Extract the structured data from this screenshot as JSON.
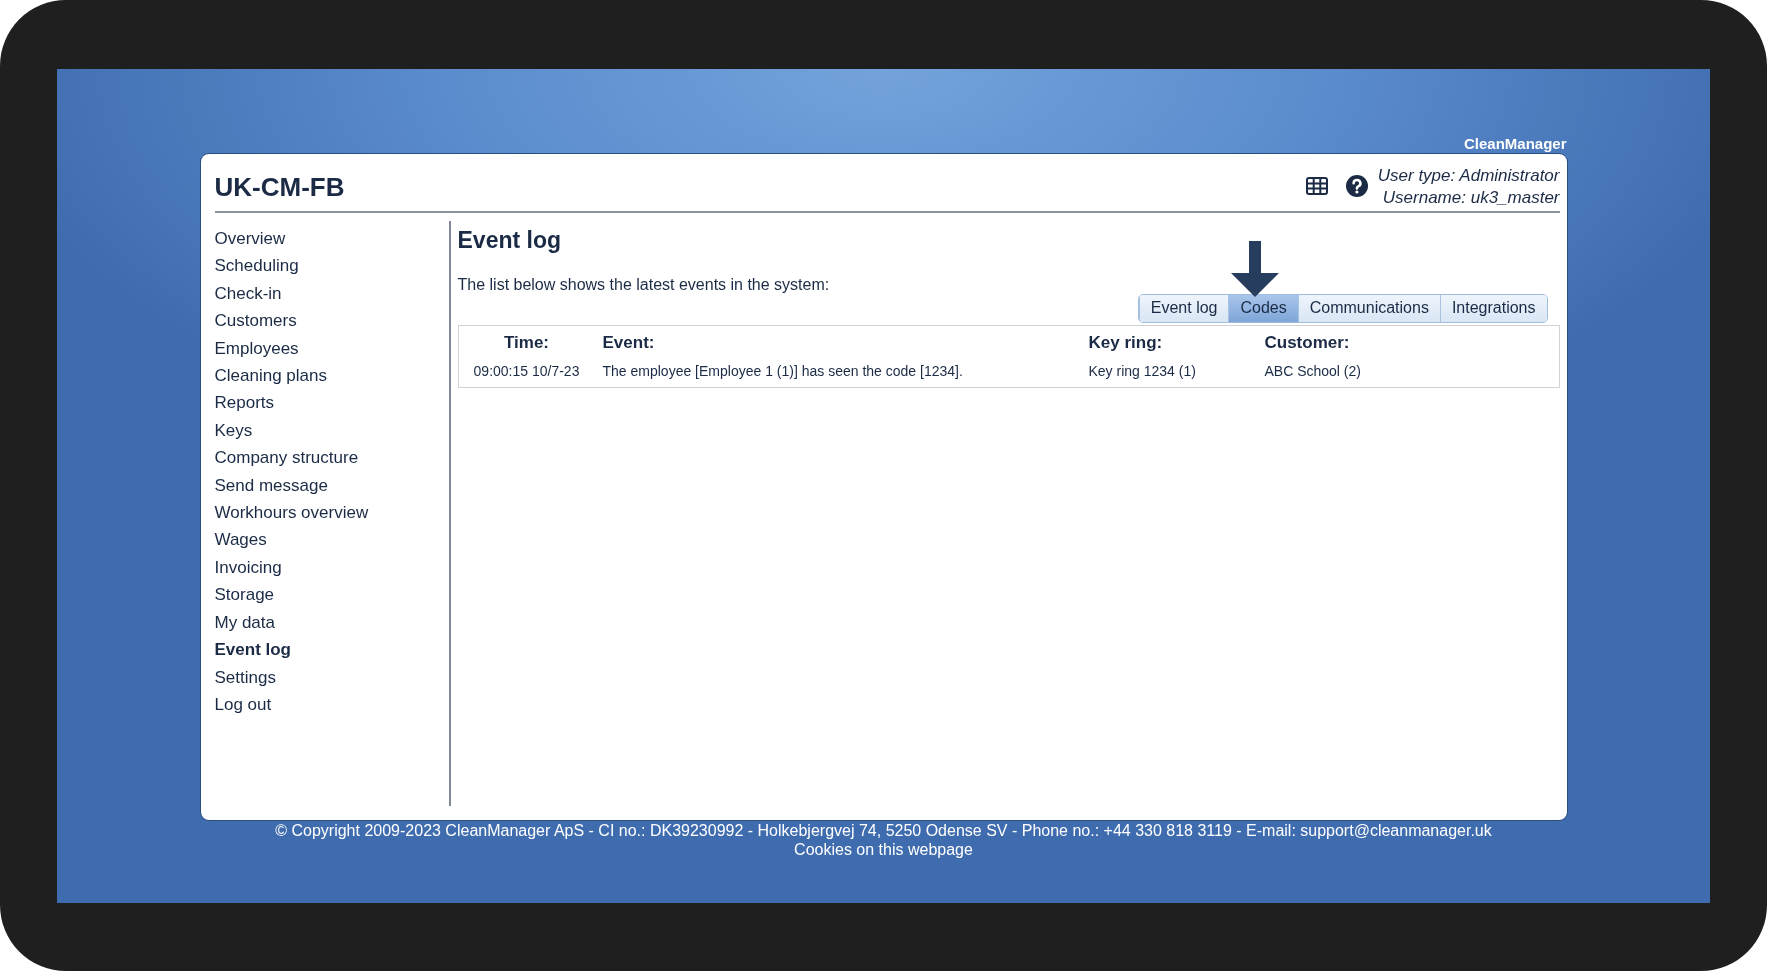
{
  "brand": "CleanManager",
  "header": {
    "title": "UK-CM-FB",
    "user_type": "User type: Administrator",
    "username": "Username: uk3_master"
  },
  "nav": [
    {
      "label": "Overview",
      "selected": false
    },
    {
      "label": "Scheduling",
      "selected": false
    },
    {
      "label": "Check-in",
      "selected": false
    },
    {
      "label": "Customers",
      "selected": false
    },
    {
      "label": "Employees",
      "selected": false
    },
    {
      "label": "Cleaning plans",
      "selected": false
    },
    {
      "label": "Reports",
      "selected": false
    },
    {
      "label": "Keys",
      "selected": false
    },
    {
      "label": "Company structure",
      "selected": false
    },
    {
      "label": "Send message",
      "selected": false
    },
    {
      "label": "Workhours overview",
      "selected": false
    },
    {
      "label": "Wages",
      "selected": false
    },
    {
      "label": "Invoicing",
      "selected": false
    },
    {
      "label": "Storage",
      "selected": false
    },
    {
      "label": "My data",
      "selected": false
    },
    {
      "label": "Event log",
      "selected": true
    },
    {
      "label": "Settings",
      "selected": false
    },
    {
      "label": "Log out",
      "selected": false
    }
  ],
  "content": {
    "title": "Event log",
    "description": "The list below shows the latest events in the system:",
    "tabs": [
      {
        "label": "Event log",
        "selected": false
      },
      {
        "label": "Codes",
        "selected": true
      },
      {
        "label": "Communications",
        "selected": false
      },
      {
        "label": "Integrations",
        "selected": false
      }
    ],
    "table": {
      "columns": [
        "Time:",
        "Event:",
        "Key ring:",
        "Customer:"
      ],
      "rows": [
        [
          "09:00:15 10/7-23",
          "The employee [Employee 1 (1)] has seen the code [1234].",
          "Key ring 1234 (1)",
          "ABC School (2)"
        ]
      ]
    }
  },
  "footer": {
    "copyright": "© Copyright 2009-2023 CleanManager ApS - CI no.: DK39230992 - Holkebjergvej 74, 5250 Odense SV - Phone no.: +44 330 818 3119 - E-mail: support@cleanmanager.uk",
    "cookies": "Cookies on this webpage"
  }
}
